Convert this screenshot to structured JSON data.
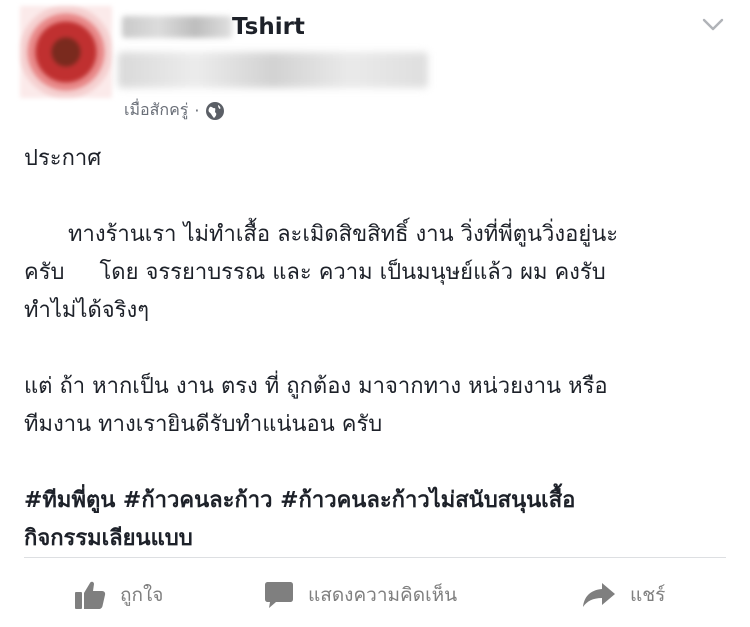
{
  "header": {
    "page_name": "Tshirt",
    "timestamp": "เมื่อสักครู่",
    "separator": "·",
    "privacy_icon": "globe-icon",
    "menu_icon": "chevron-down-icon"
  },
  "post": {
    "heading": "ประกาศ",
    "paragraph1_line1": "ทางร้านเรา ไม่ทำเสื้อ ละเมิดสิขสิทธิ์ งาน วิ่งที่พี่ตูนวิ่งอยู่นะ",
    "paragraph1_line2": "ครับ     โดย จรรยาบรรณ และ ความ เป็นมนุษย์แล้ว ผม คงรับ",
    "paragraph1_line3": "ทำไม่ได้จริงๆ",
    "paragraph2_line1": "แต่ ถ้า หากเป็น งาน ตรง ที่ ถูกต้อง มาจากทาง หน่วยงาน หรือ",
    "paragraph2_line2": "ทีมงาน ทางเรายินดีรับทำแน่นอน ครับ",
    "hashtags_line1": "#ทีมพี่ตูน #ก้าวคนละก้าว #ก้าวคนละก้าวไม่สนับสนุนเสื้อ",
    "hashtags_line2": "กิจกรรมเลียนแบบ"
  },
  "actions": {
    "like_label": "ถูกใจ",
    "comment_label": "แสดงความคิดเห็น",
    "share_label": "แชร์",
    "like_icon": "thumbs-up-icon",
    "comment_icon": "comment-icon",
    "share_icon": "share-arrow-icon"
  },
  "colors": {
    "text": "#1d2129",
    "meta_text": "#6a6f78",
    "action_text": "#7f7f7f",
    "divider": "#dddfe2"
  }
}
